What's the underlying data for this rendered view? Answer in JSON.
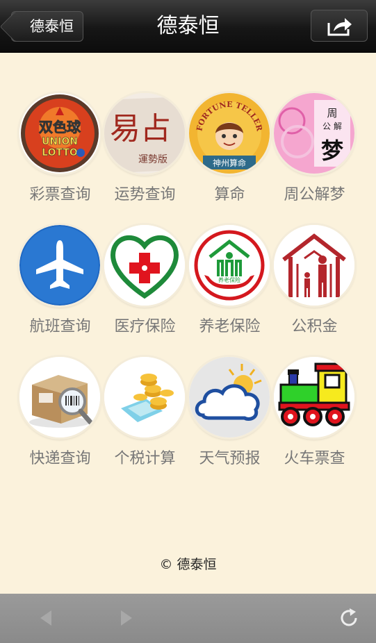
{
  "nav": {
    "back_label": "德泰恒",
    "title": "德泰恒"
  },
  "tiles": [
    {
      "label": "彩票查询",
      "icon": "lottery-icon"
    },
    {
      "label": "运势查询",
      "icon": "fortune-icon"
    },
    {
      "label": "算命",
      "icon": "fortune-teller-icon"
    },
    {
      "label": "周公解梦",
      "icon": "dream-icon"
    },
    {
      "label": "航班查询",
      "icon": "airplane-icon"
    },
    {
      "label": "医疗保险",
      "icon": "medical-icon"
    },
    {
      "label": "养老保险",
      "icon": "pension-icon"
    },
    {
      "label": "公积金",
      "icon": "housing-fund-icon"
    },
    {
      "label": "快递查询",
      "icon": "express-icon"
    },
    {
      "label": "个税计算",
      "icon": "tax-icon"
    },
    {
      "label": "天气预报",
      "icon": "weather-icon"
    },
    {
      "label": "火车票查",
      "icon": "train-icon"
    }
  ],
  "lottery_text": [
    "双色球",
    "UNION",
    "LOTTO"
  ],
  "fortune_text": [
    "易占",
    "運勢版"
  ],
  "teller_text": [
    "FORTUNE TELLER",
    "神州算命"
  ],
  "dream_text": [
    "周",
    "公",
    "解",
    "梦"
  ],
  "pension_text": "养老保险",
  "footer": "© 德泰恒",
  "colors": {
    "background": "#fbf2dc",
    "label": "#777777",
    "navbar": "#1c1c1c"
  }
}
